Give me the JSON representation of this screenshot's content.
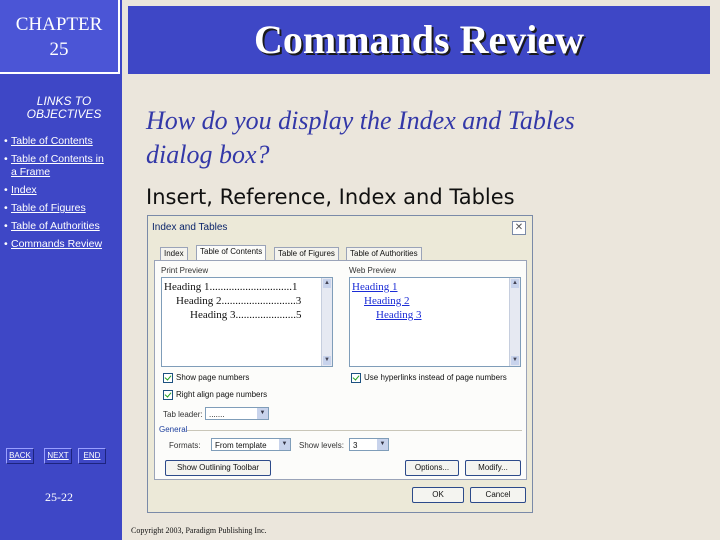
{
  "sidebar": {
    "chapter_label": "CHAPTER",
    "chapter_number": "25",
    "links_title_line1": "LINKS TO",
    "links_title_line2": "OBJECTIVES",
    "links": [
      {
        "label_line1": "Table of Contents",
        "label_line2": ""
      },
      {
        "label_line1": "Table of Contents in",
        "label_line2": "a Frame"
      },
      {
        "label_line1": "Index",
        "label_line2": ""
      },
      {
        "label_line1": "Table of Figures",
        "label_line2": ""
      },
      {
        "label_line1": "Table of Authorities",
        "label_line2": ""
      },
      {
        "label_line1": "Commands Review",
        "label_line2": ""
      }
    ],
    "nav": {
      "back": "BACK",
      "next": "NEXT",
      "end": "END"
    },
    "page_number": "25-22"
  },
  "slide": {
    "title": "Commands Review",
    "question_line1": "How do you display the Index and Tables",
    "question_line2": "dialog box?",
    "answer": "Insert, Reference, Index and Tables",
    "copyright": "Copyright 2003, Paradigm Publishing Inc."
  },
  "dialog": {
    "title": "Index and Tables",
    "close_glyph": "✕",
    "tabs": [
      "Index",
      "Table of Contents",
      "Table of Figures",
      "Table of Authorities"
    ],
    "active_tab": "Table of Contents",
    "print_preview_label": "Print Preview",
    "web_preview_label": "Web Preview",
    "print_preview_rows": [
      {
        "text": "Heading 1",
        "dots": "..............................",
        "page": "1"
      },
      {
        "text": "Heading 2",
        "dots": "...........................",
        "page": "3"
      },
      {
        "text": "Heading 3",
        "dots": "......................",
        "page": "5"
      }
    ],
    "web_preview_rows": [
      "Heading 1",
      "Heading 2",
      "Heading 3"
    ],
    "show_page_numbers": "Show page numbers",
    "right_align": "Right align page numbers",
    "use_hyperlinks": "Use hyperlinks instead of page numbers",
    "tab_leader_label": "Tab leader:",
    "tab_leader_value": ".......",
    "general_label": "General",
    "formats_label": "Formats:",
    "formats_value": "From template",
    "show_levels_label": "Show levels:",
    "show_levels_value": "3",
    "show_outlining_button": "Show Outlining Toolbar",
    "options_button": "Options...",
    "modify_button": "Modify...",
    "ok_button": "OK",
    "cancel_button": "Cancel",
    "dropdown_glyph": "▼",
    "scroll_up_glyph": "▲",
    "scroll_down_glyph": "▼"
  }
}
